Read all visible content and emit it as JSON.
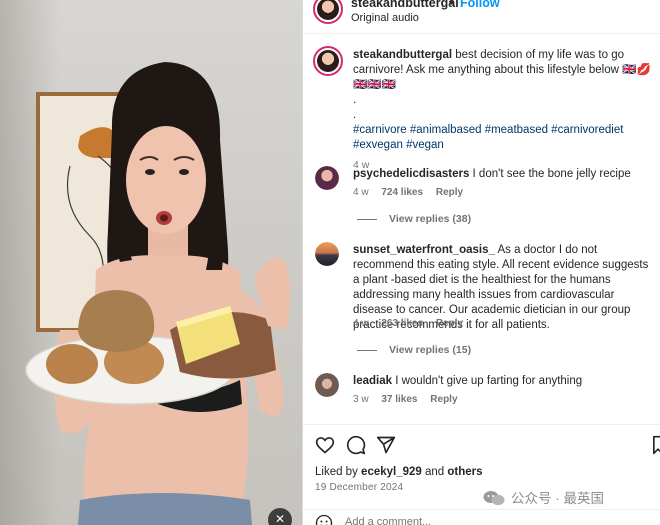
{
  "post": {
    "username": "steakandbuttergal",
    "dot": "•",
    "follow_label": "Follow",
    "audio": "Original audio",
    "caption_text": "best decision of my life was to go carnivore! Ask me anything about this lifestyle below",
    "caption_emoji": "🇬🇧💋🇬🇧🇬🇧🇬🇧",
    "dot1": ".",
    "dot2": ".",
    "hashtags": "#carnivore #animalbased #meatbased #carnivorediet #exvegan #vegan",
    "time": "4 w"
  },
  "comments": [
    {
      "username": "psychedelicdisasters",
      "text": "I don't see the bone jelly recipe",
      "time": "4 w",
      "likes": "724 likes",
      "reply": "Reply",
      "view_replies": "View replies (38)"
    },
    {
      "username": "sunset_waterfront_oasis_",
      "text": "As a doctor I do not recommend this eating style. All recent evidence suggests a plant -based diet is the healthiest for the humans addressing many health issues from cardiovascular disease to cancer. Our academic dietician in our group practice recommends it for all patients.",
      "time": "4 w",
      "likes": "263 likes",
      "reply": "Reply",
      "view_replies": "View replies (15)"
    },
    {
      "username": "leadiak",
      "text": "I wouldn't give up farting for anything",
      "time": "3 w",
      "likes": "37 likes",
      "reply": "Reply"
    }
  ],
  "footer": {
    "liked_prefix": "Liked by",
    "liked_user": "ecekyl_929",
    "liked_and": "and",
    "liked_others": "others",
    "date": "19 December 2024",
    "add_comment_placeholder": "Add a comment...",
    "watermark": "公众号 · 最英国"
  },
  "icons": {
    "like": "heart-icon",
    "comment": "comment-icon",
    "share": "share-icon",
    "save": "bookmark-icon",
    "mute": "speaker-muted-icon",
    "emoji": "emoji-icon"
  },
  "colors": {
    "link": "#00376b",
    "follow": "#0095f6",
    "muted": "#737373",
    "story_ring": "#d62976"
  }
}
